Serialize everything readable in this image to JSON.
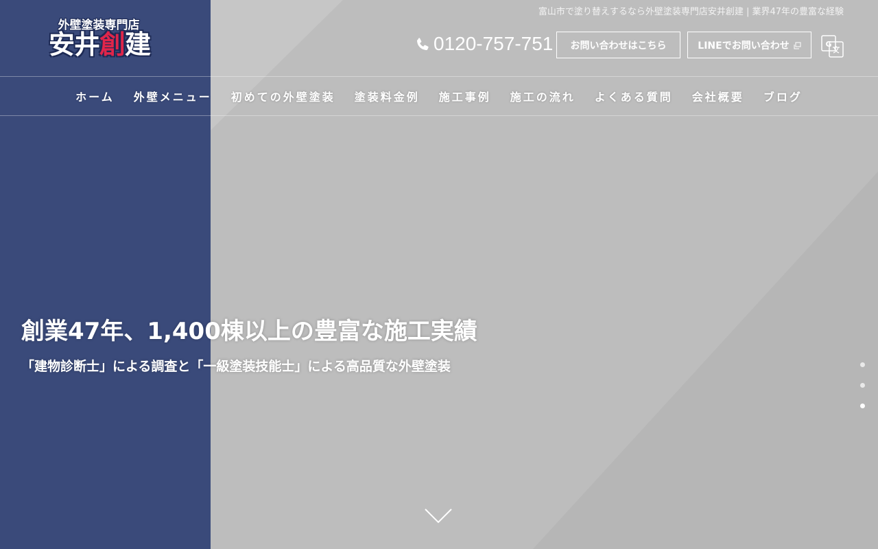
{
  "header": {
    "logo": {
      "top_text": "外壁塗装専門店",
      "main_text_before": "安井",
      "main_text_accent": "創",
      "main_text_after": "建"
    },
    "tagline": "富山市で塗り替えするなら外壁塗装専門店安井創建 | 業界47年の豊富な経験",
    "phone": "0120-757-751",
    "contact_button": "お問い合わせはこちら",
    "line_button": "LINEでお問い合わせ",
    "translate_icon": "google-translate-icon"
  },
  "nav": {
    "items": [
      {
        "label": "ホーム"
      },
      {
        "label": "外壁メニュー"
      },
      {
        "label": "初めての外壁塗装"
      },
      {
        "label": "塗装料金例"
      },
      {
        "label": "施工事例"
      },
      {
        "label": "施工の流れ"
      },
      {
        "label": "よくある質問"
      },
      {
        "label": "会社概要"
      },
      {
        "label": "ブログ"
      }
    ]
  },
  "hero": {
    "title": "創業47年、1,400棟以上の豊富な施工実績",
    "subtitle": "「建物診断士」による調査と「一級塗装技能士」による高品質な外壁塗装",
    "slides": {
      "count": 3,
      "active": 3
    }
  },
  "colors": {
    "brand_blue": "#3a4a7a",
    "accent_red": "#e0254a",
    "hero_gray": "#bfbfbf"
  }
}
